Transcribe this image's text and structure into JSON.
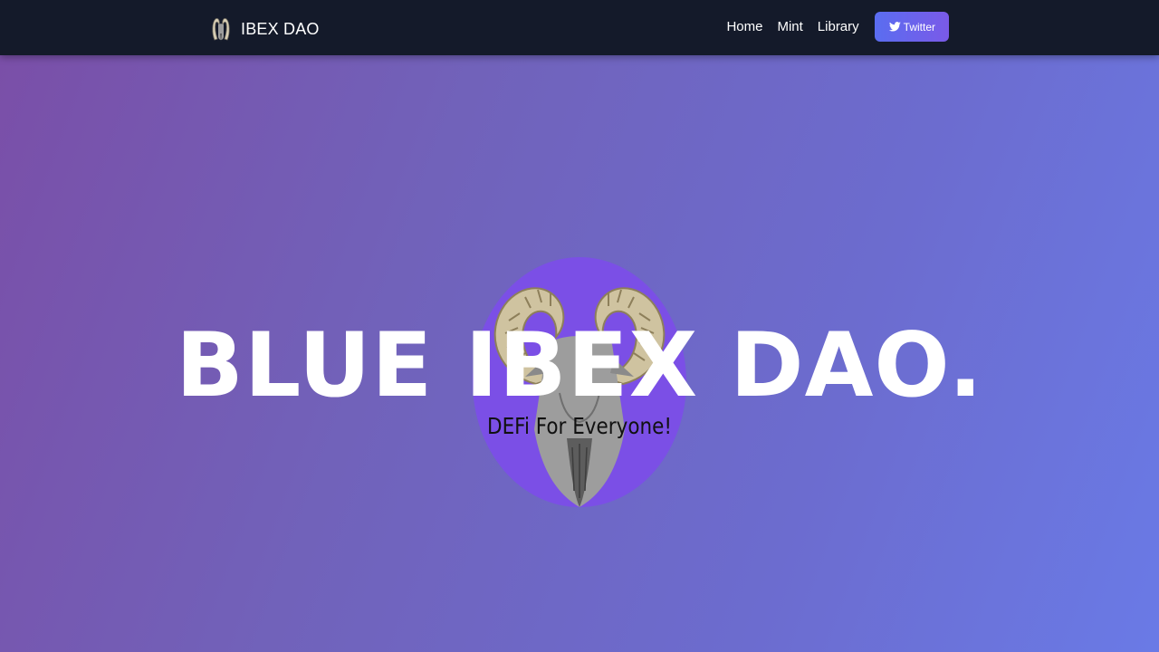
{
  "navbar": {
    "brand_name": "IBEX DAO",
    "brand_logo": "ibex-logo-icon",
    "links": [
      {
        "label": "Home"
      },
      {
        "label": "Mint"
      },
      {
        "label": "Library"
      }
    ],
    "twitter": {
      "label": "Twitter",
      "icon": "twitter-bird-icon"
    }
  },
  "hero": {
    "title": "BLUE IBEX DAO.",
    "subtitle": "DEFi For Everyone!",
    "image": "ibex-portrait-image"
  },
  "colors": {
    "navbar_bg": "#141a2a",
    "hero_gradient_start": "#7a4fa8",
    "hero_gradient_end": "#6a7ae6",
    "circle_purple": "#7b4fe6",
    "button_gradient_start": "#5a6df0",
    "button_gradient_end": "#7a5ae8"
  }
}
